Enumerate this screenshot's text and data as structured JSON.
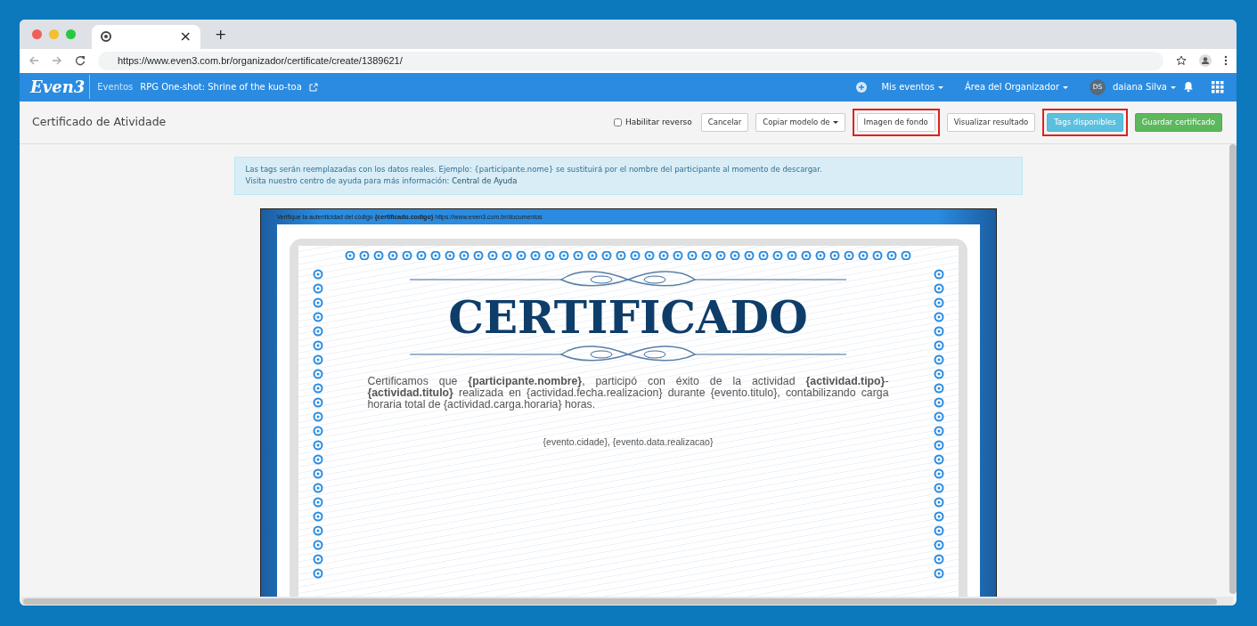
{
  "browser": {
    "tab_close": "×",
    "new_tab": "+",
    "url": "https://www.even3.com.br/organizador/certificate/create/1389621/"
  },
  "navbar": {
    "logo": "Even3",
    "section": "Eventos",
    "event": "RPG One-shot: Shrine of the kuo-toa",
    "menus": [
      "Mis eventos",
      "Área del Organizador"
    ],
    "avatar": "DS",
    "user": "daiana Silva"
  },
  "toolbar": {
    "title": "Certificado de Atividade",
    "reverse": {
      "label": "Habilitar reverso",
      "checked": false
    },
    "buttons": [
      {
        "label": "Cancelar",
        "kind": "default",
        "dropdown": false,
        "highlighted": false
      },
      {
        "label": "Copiar modelo de",
        "kind": "default",
        "dropdown": true,
        "highlighted": false
      },
      {
        "label": "Imagen de fondo",
        "kind": "default",
        "dropdown": false,
        "highlighted": true
      },
      {
        "label": "Visualizar resultado",
        "kind": "default",
        "dropdown": false,
        "highlighted": false
      },
      {
        "label": "Tags disponibles",
        "kind": "info",
        "dropdown": false,
        "highlighted": true
      },
      {
        "label": "Guardar certificado",
        "kind": "success",
        "dropdown": false,
        "highlighted": false
      }
    ]
  },
  "alert": {
    "line1": "Las tags serán reemplazadas con los datos reales. Ejemplo: {participante.nome} se sustituirá por el nombre del participante al momento de descargar.",
    "line2": "Visita nuestro centro de ayuda para más información:",
    "link": "Central de Ayuda"
  },
  "certificate": {
    "verify": "Verifique la autenticidad del código **{certificado.codigo}** https://www.even3.com.br/documentos",
    "title": "CERTIFICADO",
    "body": "Certificamos que **{participante.nombre}**, participó con éxito de la actividad **{actividad.tipo}**-**{actividad.titulo}** realizada en {actividad.fecha.realizacion} durante {evento.titulo}, contabilizando carga horaria total de {actividad.carga.horaria} horas.",
    "place_date": "{evento.cidade}, {evento.data.realizacao}"
  }
}
